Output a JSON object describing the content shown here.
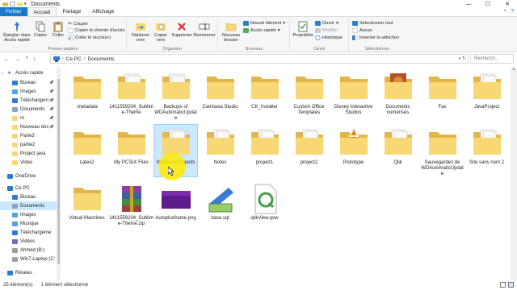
{
  "window": {
    "title": "Documents",
    "controls": {
      "minimize": "—",
      "maximize": "☐",
      "close": "✕"
    }
  },
  "ribbon_tabs": [
    "Fichier",
    "Accueil",
    "Partage",
    "Affichage"
  ],
  "ribbon": {
    "presse_papiers": {
      "label": "Presse-papiers",
      "pin": "Épingler dans\nAccès rapide",
      "copier": "Copier",
      "coller": "Coller",
      "couper": "Couper",
      "copier_chemin": "Copier le chemin d'accès",
      "coller_raccourci": "Coller le raccourci"
    },
    "organiser": {
      "label": "Organiser",
      "deplacer": "Déplacer vers",
      "copier_vers": "Copier vers",
      "supprimer": "Supprimer",
      "renommer": "Renommer"
    },
    "nouveau": {
      "label": "Nouveau",
      "nouveau_dossier": "Nouveau dossier",
      "nouvel_element": "Nouvel élément",
      "acces_rapide": "Accès rapide"
    },
    "ouvrir": {
      "label": "Ouvrir",
      "proprietes": "Propriétés",
      "ouvrir": "Ouvrir",
      "modifier": "Modifier",
      "historique": "Historique"
    },
    "selectionner": {
      "label": "Sélectionner",
      "tout": "Sélectionner tout",
      "aucun": "Aucun",
      "inverser": "Inverser la sélection"
    }
  },
  "address": {
    "path": [
      "Ce PC",
      "Documents"
    ],
    "search_placeholder": "Recherch..."
  },
  "sidebar": [
    {
      "label": "Accès rapide",
      "icon": "star-icon",
      "level": 0
    },
    {
      "label": "Bureau",
      "icon": "desktop-icon",
      "level": 1,
      "pinned": true
    },
    {
      "label": "Images",
      "icon": "pictures-icon",
      "level": 1,
      "pinned": true
    },
    {
      "label": "Téléchargem",
      "icon": "download-icon",
      "level": 1,
      "pinned": true
    },
    {
      "label": "Documents",
      "icon": "documents-icon",
      "level": 1,
      "pinned": true
    },
    {
      "label": "m",
      "icon": "folder-icon",
      "level": 1,
      "pinned": true
    },
    {
      "label": "Nouveau dos",
      "icon": "folder-icon",
      "level": 1,
      "pinned": true
    },
    {
      "label": "Parte3",
      "icon": "folder-icon",
      "level": 1
    },
    {
      "label": "partie2",
      "icon": "folder-icon",
      "level": 1
    },
    {
      "label": "Project java",
      "icon": "folder-icon",
      "level": 1
    },
    {
      "label": "Video",
      "icon": "folder-icon",
      "level": 1
    },
    {
      "label": "OneDrive",
      "icon": "cloud-icon",
      "level": 0
    },
    {
      "label": "Ce PC",
      "icon": "computer-icon",
      "level": 0
    },
    {
      "label": "Bureau",
      "icon": "desktop-icon",
      "level": 1
    },
    {
      "label": "Documents",
      "icon": "documents-icon",
      "level": 1,
      "selected": true
    },
    {
      "label": "Images",
      "icon": "pictures-icon",
      "level": 1
    },
    {
      "label": "Musique",
      "icon": "music-icon",
      "level": 1
    },
    {
      "label": "Téléchargeme",
      "icon": "download-icon",
      "level": 1
    },
    {
      "label": "Vidéos",
      "icon": "video-icon",
      "level": 1
    },
    {
      "label": "Ahmed (B:)",
      "icon": "drive-icon",
      "level": 1
    },
    {
      "label": "Win7.Laptop (C:",
      "icon": "drive-icon",
      "level": 1
    },
    {
      "label": "Réseau",
      "icon": "network-icon",
      "level": 0
    }
  ],
  "items": [
    {
      "label": ".metadata",
      "type": "folder"
    },
    {
      "label": "1411559204_Sublime-Theme",
      "type": "folder-docs"
    },
    {
      "label": "Backups of WDAutomaticUpdate",
      "type": "folder-docs"
    },
    {
      "label": "Camtasia Studio",
      "type": "folder"
    },
    {
      "label": "CK_Installer",
      "type": "folder"
    },
    {
      "label": "Custom Office Templates",
      "type": "folder"
    },
    {
      "label": "Disney Interactive Studios",
      "type": "folder"
    },
    {
      "label": "Documents numérisés",
      "type": "folder-image"
    },
    {
      "label": "Fax",
      "type": "folder"
    },
    {
      "label": "JavaProject",
      "type": "folder-docs"
    },
    {
      "label": "Latex2",
      "type": "folder"
    },
    {
      "label": "My PCTeX Files",
      "type": "folder"
    },
    {
      "label": "NetBeansProjects",
      "type": "folder-docs",
      "selected": true
    },
    {
      "label": "Notes",
      "type": "folder-docs"
    },
    {
      "label": "project1",
      "type": "folder-docs"
    },
    {
      "label": "project2",
      "type": "folder-docs"
    },
    {
      "label": "Prototype",
      "type": "folder-vlc"
    },
    {
      "label": "Qlik",
      "type": "folder-docs"
    },
    {
      "label": "Sauvegardes de WDAutomaticUpdate",
      "type": "folder"
    },
    {
      "label": "Site sans nom 2",
      "type": "folder-docs"
    },
    {
      "label": "Virtual Machines",
      "type": "folder"
    },
    {
      "label": "1411559204_Sublime-Theme.zip",
      "type": "rar"
    },
    {
      "label": "Autoplusframe.png",
      "type": "png"
    },
    {
      "label": "base.sql",
      "type": "sql"
    },
    {
      "label": "qlikView.qvw",
      "type": "qvw"
    }
  ],
  "status": {
    "count": "25 élément(s)",
    "selection": "1 élément sélectionné"
  },
  "colors": {
    "folder": "#f8d775",
    "folder_dark": "#e3b64a",
    "selection": "#cce8ff",
    "accent": "#1979ca",
    "cursor_highlight": "#ffeb00"
  }
}
